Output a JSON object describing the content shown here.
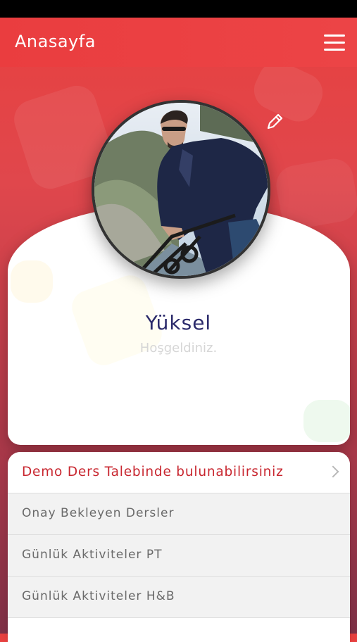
{
  "header": {
    "title": "Anasayfa",
    "menu_icon": "hamburger-menu-icon"
  },
  "profile": {
    "name": "Yüksel",
    "welcome": "Hoşgeldiniz.",
    "edit_icon": "pencil-icon"
  },
  "menu": {
    "items": [
      {
        "label": "Demo Ders Talebinde bulunabilirsiniz",
        "highlight": true
      },
      {
        "label": "Onay Bekleyen Dersler",
        "highlight": false
      },
      {
        "label": "Günlük Aktiviteler PT",
        "highlight": false
      },
      {
        "label": "Günlük Aktiviteler H&B",
        "highlight": false
      },
      {
        "label": "",
        "highlight": false
      }
    ]
  },
  "colors": {
    "accent": "#e8403f",
    "highlight_text": "#c8262f",
    "name_text": "#2b2a6b"
  }
}
